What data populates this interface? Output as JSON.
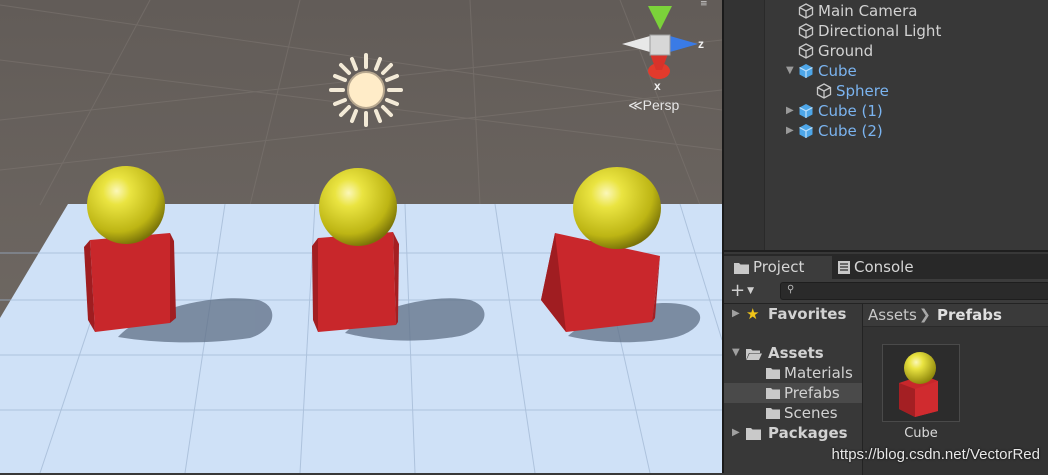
{
  "scene_view": {
    "projection_label": "Persp",
    "axis_labels": {
      "x": "x",
      "z": "z"
    },
    "colors": {
      "sky": "#6b645f",
      "plane": "#cfe2f8",
      "cube": "#c8272b",
      "sphere": "#e2dd2c"
    }
  },
  "hierarchy": {
    "items": [
      {
        "label": "Main Camera",
        "type": "gameobject"
      },
      {
        "label": "Directional Light",
        "type": "gameobject"
      },
      {
        "label": "Ground",
        "type": "gameobject"
      },
      {
        "label": "Cube",
        "type": "prefab",
        "expanded": true
      },
      {
        "label": "Sphere",
        "type": "prefab-child"
      },
      {
        "label": "Cube (1)",
        "type": "prefab",
        "expanded": false
      },
      {
        "label": "Cube (2)",
        "type": "prefab",
        "expanded": false
      }
    ]
  },
  "project": {
    "tabs": [
      {
        "label": "Project",
        "icon": "folder-icon",
        "active": true
      },
      {
        "label": "Console",
        "icon": "console-icon",
        "active": false
      }
    ],
    "search": {
      "placeholder": ""
    },
    "tree": {
      "favorites": "Favorites",
      "assets": "Assets",
      "folders": [
        "Materials",
        "Prefabs",
        "Scenes"
      ],
      "packages": "Packages",
      "selected": "Prefabs"
    },
    "breadcrumb": {
      "root": "Assets",
      "current": "Prefabs"
    },
    "assets": [
      {
        "name": "Cube",
        "kind": "prefab"
      }
    ]
  },
  "watermark": "https://blog.csdn.net/VectorRed"
}
